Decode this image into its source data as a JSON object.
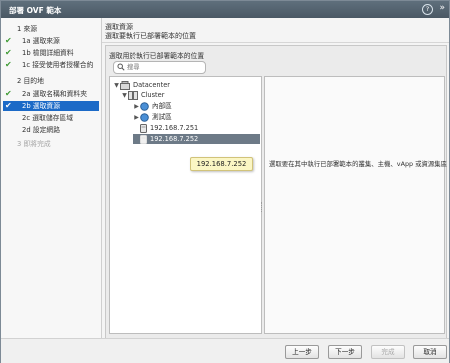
{
  "window": {
    "title": "部署 OVF 範本",
    "help_label": "?",
    "expand_label": "»"
  },
  "sidebar": {
    "steps": [
      {
        "label": "1 來源",
        "checked": false,
        "level": "top"
      },
      {
        "label": "1a 選取來源",
        "checked": true,
        "level": "sub"
      },
      {
        "label": "1b 檢閱詳細資料",
        "checked": true,
        "level": "sub"
      },
      {
        "label": "1c 接受使用者授權合約",
        "checked": true,
        "level": "sub"
      },
      {
        "label": "2 目的地",
        "checked": false,
        "level": "top"
      },
      {
        "label": "2a 選取名稱和資料夾",
        "checked": true,
        "level": "sub"
      },
      {
        "label": "2b 選取資源",
        "checked": true,
        "level": "sub",
        "selected": true
      },
      {
        "label": "2c 選取儲存區域",
        "checked": false,
        "level": "sub"
      },
      {
        "label": "2d 設定網路",
        "checked": false,
        "level": "sub"
      },
      {
        "label": "3 即將完成",
        "checked": false,
        "level": "top",
        "disabled": true
      }
    ]
  },
  "header": {
    "title": "選取資源",
    "description": "選取要執行已部署範本的位置"
  },
  "content": {
    "pane_title": "選取用於執行已部署範本的位置",
    "search_placeholder": "搜尋",
    "tree": [
      {
        "label": "Datacenter",
        "icon": "datacenter-icon",
        "expander": "▼"
      },
      {
        "label": "Cluster",
        "icon": "cluster-icon",
        "expander": "▼"
      },
      {
        "label": "內部區",
        "icon": "resource-pool-icon",
        "expander": "▶"
      },
      {
        "label": "測試區",
        "icon": "resource-pool-icon",
        "expander": "▶"
      },
      {
        "label": "192.168.7.251",
        "icon": "host-icon",
        "expander": ""
      },
      {
        "label": "192.168.7.252",
        "icon": "host-icon",
        "expander": "",
        "selected": true
      }
    ],
    "tooltip": "192.168.7.252",
    "info_text": "選取要在其中執行已部署範本的叢集、主機、vApp 或資源集區"
  },
  "footer": {
    "back_label": "上一步",
    "next_label": "下一步",
    "finish_label": "完成",
    "cancel_label": "取消"
  },
  "colors": {
    "selected_step": "#1c6ac7",
    "selected_row": "#6d7a87",
    "check": "#3f9b35",
    "titlebar": "#4f5e6b"
  }
}
